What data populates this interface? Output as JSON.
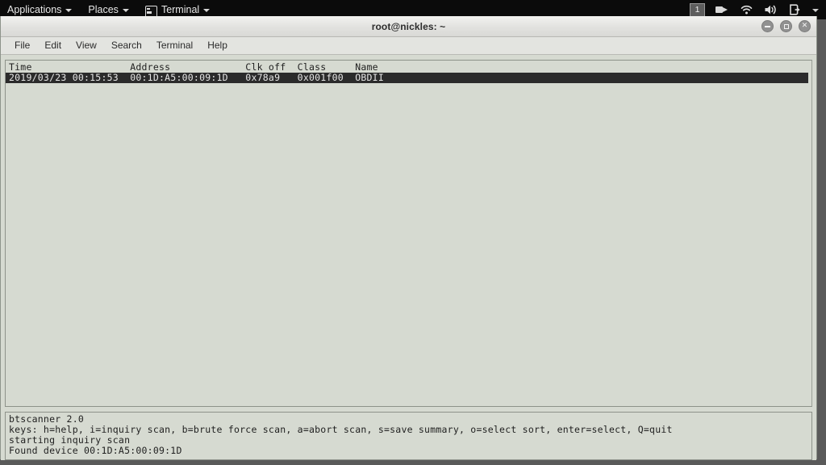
{
  "desktop": {
    "panel": {
      "menus": [
        {
          "label": "Applications",
          "icon": null
        },
        {
          "label": "Places",
          "icon": null
        },
        {
          "label": "Terminal",
          "icon": "terminal-icon"
        }
      ],
      "tray": {
        "workspace": "1",
        "icons": [
          "screen-recorder-icon",
          "wifi-icon",
          "volume-icon",
          "power-icon"
        ],
        "dropdown": "chevron-down-icon"
      }
    },
    "background_color": "#5a5a5a",
    "panel_color": "#0b0b0b"
  },
  "window": {
    "title": "root@nickles: ~",
    "controls": {
      "minimize": "minimize-button",
      "maximize": "maximize-button",
      "close": "close-button"
    },
    "menubar": [
      "File",
      "Edit",
      "View",
      "Search",
      "Terminal",
      "Help"
    ]
  },
  "terminal": {
    "app": "btscanner",
    "list": {
      "header": "Time                 Address             Clk off  Class     Name",
      "columns": [
        "Time",
        "Address",
        "Clk off",
        "Class",
        "Name"
      ],
      "rows": [
        {
          "time": "2019/03/23 00:15:53",
          "address": "00:1D:A5:00:09:1D",
          "clk_off": "0x78a9",
          "class": "0x001f00",
          "name": "OBDII",
          "selected": true,
          "text": "2019/03/23 00:15:53  00:1D:A5:00:09:1D   0x78a9   0x001f00  OBDII"
        }
      ],
      "selection_bg": "#2b2b2b",
      "selection_fg": "#e6e6e6"
    },
    "status": {
      "lines": [
        "btscanner 2.0",
        "keys: h=help, i=inquiry scan, b=brute force scan, a=abort scan, s=save summary, o=select sort, enter=select, Q=quit",
        "starting inquiry scan",
        "Found device 00:1D:A5:00:09:1D"
      ]
    },
    "background_color": "#d6dad1",
    "foreground_color": "#1c1c1c"
  }
}
